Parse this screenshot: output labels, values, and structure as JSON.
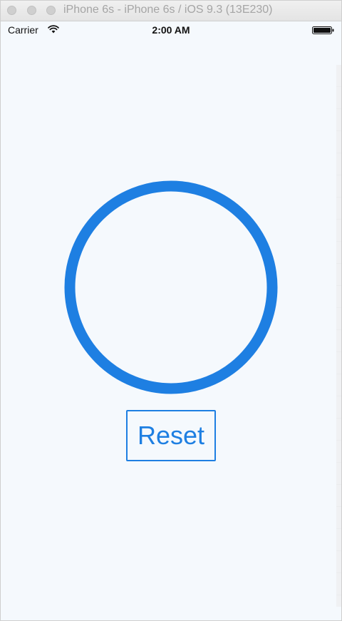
{
  "window": {
    "title": "iPhone 6s - iPhone 6s / iOS 9.3 (13E230)"
  },
  "status_bar": {
    "carrier": "Carrier",
    "time": "2:00 AM",
    "wifi_icon": "wifi-icon",
    "battery_icon": "battery-icon"
  },
  "app": {
    "ring_color": "#1e7fe2",
    "reset_label": "Reset"
  }
}
